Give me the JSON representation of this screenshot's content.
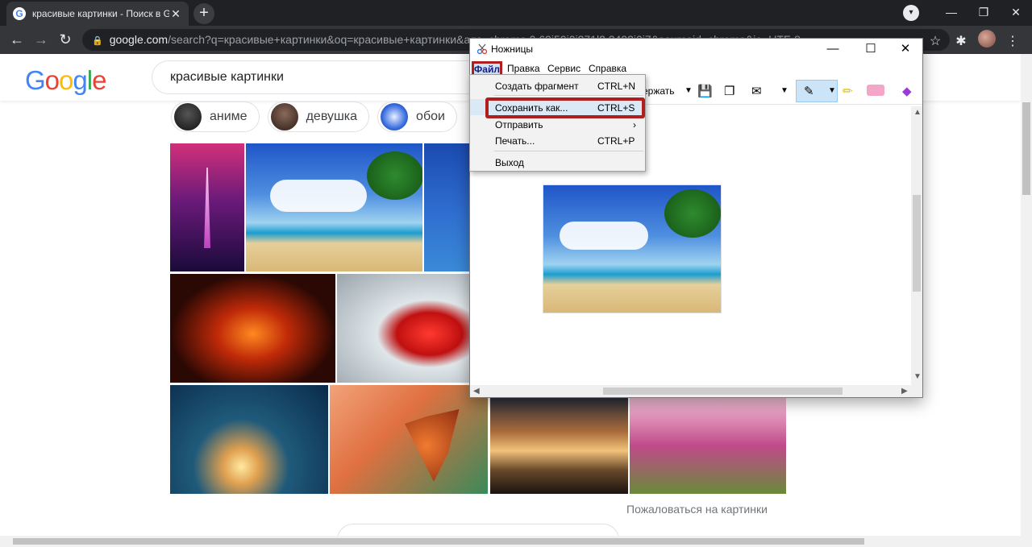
{
  "browser": {
    "tab_title": "красивые картинки - Поиск в Google",
    "new_tab": "+",
    "tab_close": "✕",
    "url_host": "google.com",
    "url_rest": "/search?q=красивые+картинки&oq=красивые+картинки&aqs=chrome.0.69i59j0i271l2.3492j0j7&sourceid=chrome&ie=UTF-8"
  },
  "google": {
    "logo": [
      "G",
      "o",
      "o",
      "g",
      "l",
      "e"
    ],
    "query": "красивые картинки",
    "chips": [
      {
        "label": "аниме"
      },
      {
        "label": "девушка"
      },
      {
        "label": "обои"
      }
    ],
    "report_link": "Пожаловаться на картинки"
  },
  "snip": {
    "title": "Ножницы",
    "menu": {
      "file": "Файл",
      "edit": "Правка",
      "service": "Сервис",
      "help": "Справка"
    },
    "delay_label": "ержать",
    "dropdown": [
      {
        "label": "Создать фрагмент",
        "shortcut": "CTRL+N"
      },
      {
        "label": "Сохранить как...",
        "shortcut": "CTRL+S"
      },
      {
        "label": "Отправить",
        "shortcut": "›"
      },
      {
        "label": "Печать...",
        "shortcut": "CTRL+P"
      },
      {
        "label": "Выход",
        "shortcut": ""
      }
    ]
  },
  "colors": {
    "highlight_red": "#b01e1e",
    "chrome_dark": "#202124"
  }
}
